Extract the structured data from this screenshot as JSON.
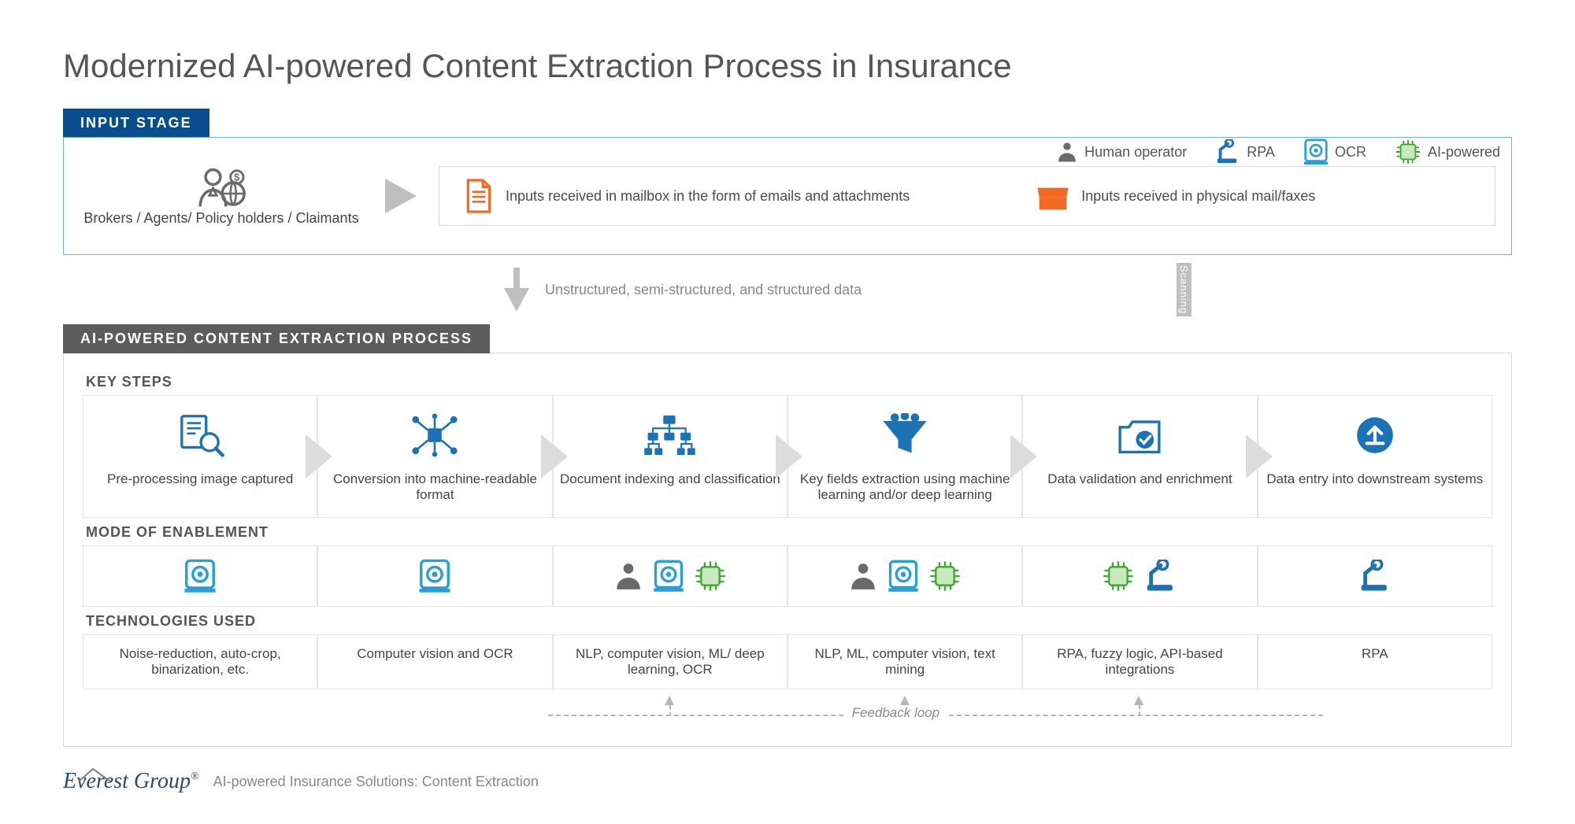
{
  "title": "Modernized AI-powered Content Extraction Process in Insurance",
  "legend": {
    "human": "Human operator",
    "rpa": "RPA",
    "ocr": "OCR",
    "ai": "AI-powered"
  },
  "input_stage": {
    "tab": "INPUT STAGE",
    "broker_label": "Brokers / Agents/ Policy holders / Claimants",
    "email_label": "Inputs received in mailbox in the form of emails and attachments",
    "physical_label": "Inputs received in physical mail/faxes",
    "mid_annotation": "Unstructured, semi-structured, and structured data",
    "scanning_label": "Scanning"
  },
  "process": {
    "tab": "AI-POWERED CONTENT EXTRACTION PROCESS",
    "rows": {
      "key_steps": "KEY STEPS",
      "mode": "MODE OF ENABLEMENT",
      "tech": "TECHNOLOGIES USED"
    },
    "steps": [
      {
        "label": "Pre-processing image captured"
      },
      {
        "label": "Conversion into machine-readable format"
      },
      {
        "label": "Document indexing and classification"
      },
      {
        "label": "Key fields extraction using machine learning and/or deep learning"
      },
      {
        "label": "Data validation and enrichment"
      },
      {
        "label": "Data entry into downstream systems"
      }
    ],
    "technologies": [
      "Noise-reduction, auto-crop, binarization, etc.",
      "Computer vision and OCR",
      "NLP, computer vision, ML/ deep learning, OCR",
      "NLP, ML, computer vision, text mining",
      "RPA, fuzzy logic, API-based integrations",
      "RPA"
    ],
    "feedback_label": "Feedback loop"
  },
  "footer": {
    "brand": "Everest Group",
    "registered": "®",
    "subtitle": "AI-powered Insurance Solutions: Content Extraction"
  },
  "colors": {
    "blue": "#1b72b5",
    "darkblue": "#0a4d8c",
    "orange": "#f26a21",
    "green": "#62c04a",
    "gray": "#6a6a6a"
  }
}
